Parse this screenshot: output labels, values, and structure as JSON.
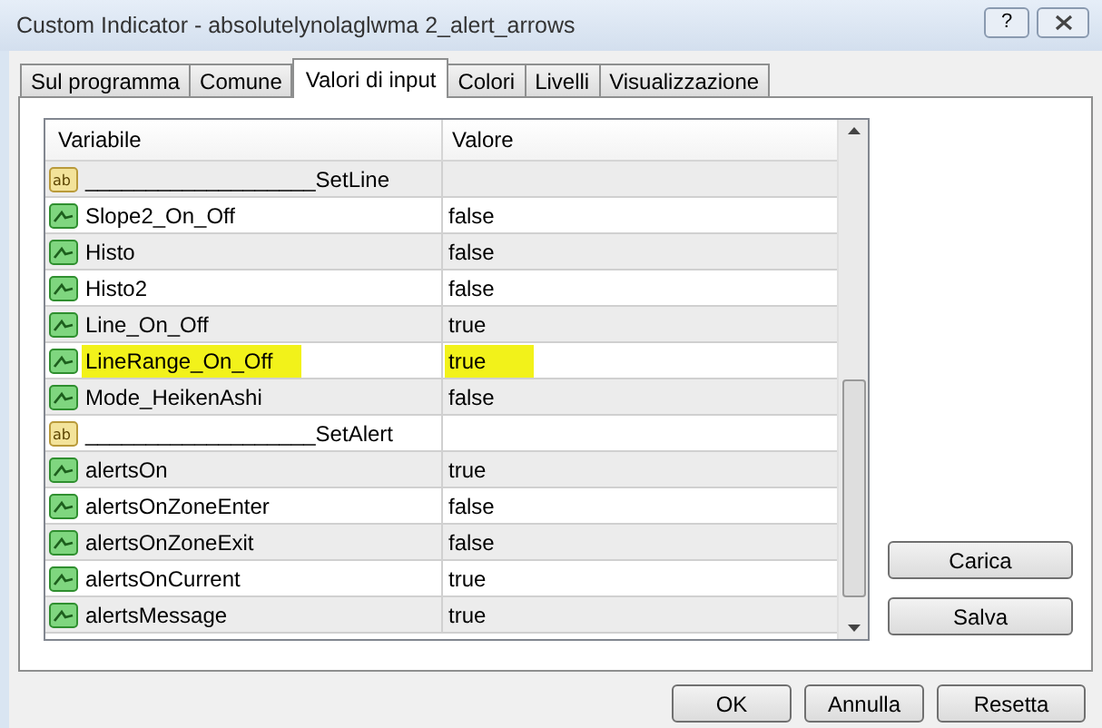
{
  "window": {
    "title": "Custom Indicator - absolutelynolaglwma 2_alert_arrows",
    "help_button": "?"
  },
  "tabs": [
    {
      "label": "Sul programma",
      "selected": false
    },
    {
      "label": "Comune",
      "selected": false
    },
    {
      "label": "Valori di input",
      "selected": true
    },
    {
      "label": "Colori",
      "selected": false
    },
    {
      "label": "Livelli",
      "selected": false
    },
    {
      "label": "Visualizzazione",
      "selected": false
    }
  ],
  "table": {
    "columns": [
      "Variabile",
      "Valore"
    ],
    "rows": [
      {
        "kind": "separator",
        "icon_text": "ab",
        "name": "___________________SetLine",
        "value": "",
        "highlighted": false
      },
      {
        "kind": "param",
        "name": "Slope2_On_Off",
        "value": "false",
        "highlighted": false
      },
      {
        "kind": "param",
        "name": "Histo",
        "value": "false",
        "highlighted": false
      },
      {
        "kind": "param",
        "name": "Histo2",
        "value": "false",
        "highlighted": false
      },
      {
        "kind": "param",
        "name": "Line_On_Off",
        "value": "true",
        "highlighted": false
      },
      {
        "kind": "param",
        "name": "LineRange_On_Off",
        "value": "true",
        "highlighted": true
      },
      {
        "kind": "param",
        "name": "Mode_HeikenAshi",
        "value": "false",
        "highlighted": false
      },
      {
        "kind": "separator",
        "icon_text": "ab",
        "name": "___________________SetAlert",
        "value": "",
        "highlighted": false
      },
      {
        "kind": "param",
        "name": "alertsOn",
        "value": "true",
        "highlighted": false
      },
      {
        "kind": "param",
        "name": "alertsOnZoneEnter",
        "value": "false",
        "highlighted": false
      },
      {
        "kind": "param",
        "name": "alertsOnZoneExit",
        "value": "false",
        "highlighted": false
      },
      {
        "kind": "param",
        "name": "alertsOnCurrent",
        "value": "true",
        "highlighted": false
      },
      {
        "kind": "param",
        "name": "alertsMessage",
        "value": "true",
        "highlighted": false
      }
    ]
  },
  "side_buttons": [
    "Carica",
    "Salva"
  ],
  "buttons": [
    "OK",
    "Annulla",
    "Resetta"
  ]
}
